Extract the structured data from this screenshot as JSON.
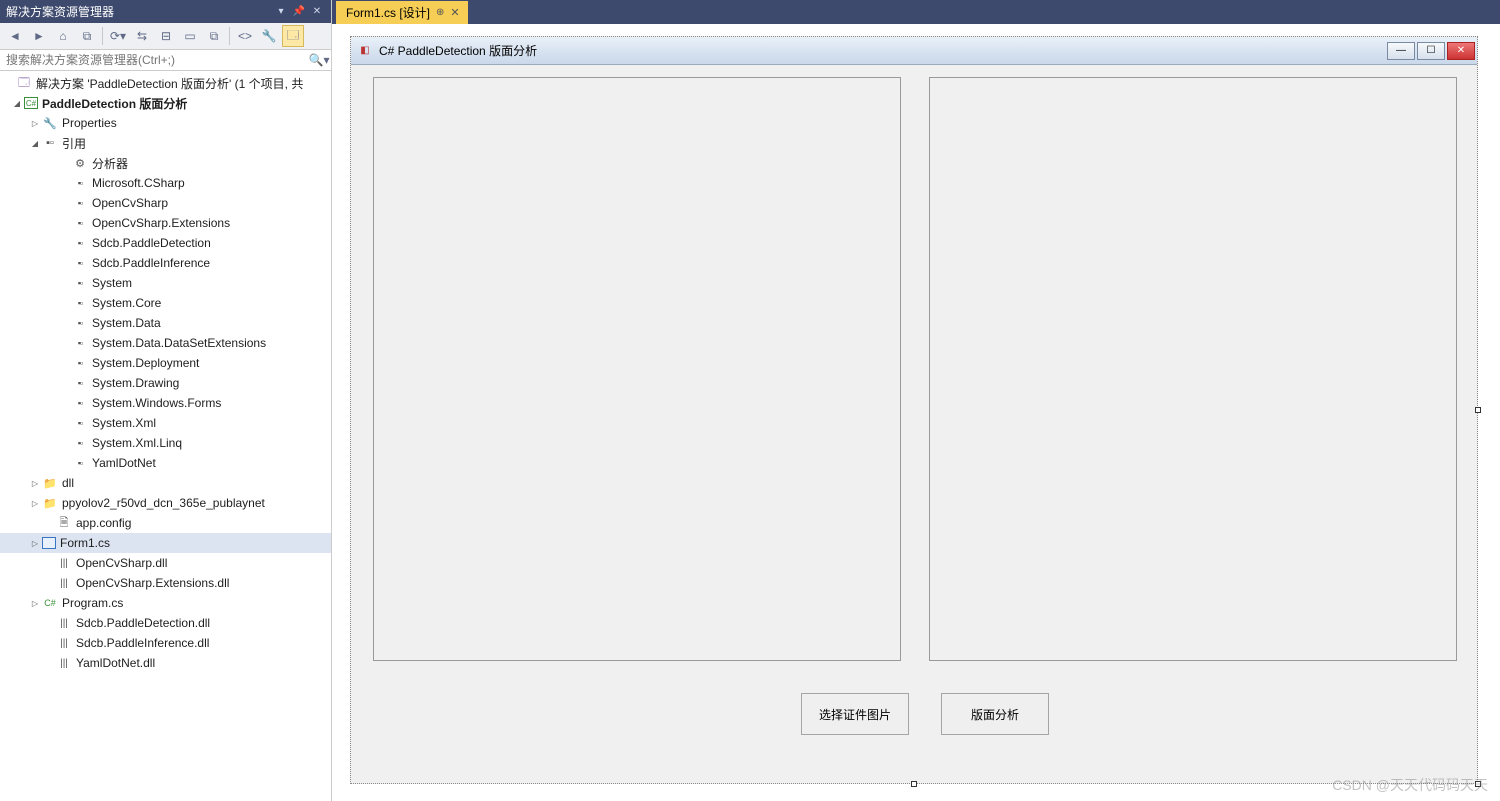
{
  "solutionExplorer": {
    "title": "解决方案资源管理器",
    "searchPlaceholder": "搜索解决方案资源管理器(Ctrl+;)",
    "tree": {
      "solution": "解决方案 'PaddleDetection 版面分析' (1 个项目, 共",
      "project": "PaddleDetection 版面分析",
      "properties": "Properties",
      "references": "引用",
      "analyzers": "分析器",
      "refs": [
        "Microsoft.CSharp",
        "OpenCvSharp",
        "OpenCvSharp.Extensions",
        "Sdcb.PaddleDetection",
        "Sdcb.PaddleInference",
        "System",
        "System.Core",
        "System.Data",
        "System.Data.DataSetExtensions",
        "System.Deployment",
        "System.Drawing",
        "System.Windows.Forms",
        "System.Xml",
        "System.Xml.Linq",
        "YamlDotNet"
      ],
      "folder1": "dll",
      "folder2": "ppyolov2_r50vd_dcn_365e_publaynet",
      "appconfig": "app.config",
      "form1": "Form1.cs",
      "files": [
        "OpenCvSharp.dll",
        "OpenCvSharp.Extensions.dll"
      ],
      "program": "Program.cs",
      "dlls": [
        "Sdcb.PaddleDetection.dll",
        "Sdcb.PaddleInference.dll",
        "YamlDotNet.dll"
      ]
    }
  },
  "editor": {
    "tab": {
      "label": "Form1.cs [设计]"
    }
  },
  "designer": {
    "formTitle": "C# PaddleDetection 版面分析",
    "button1": "选择证件图片",
    "button2": "版面分析"
  },
  "watermark": "CSDN @天天代码码天天"
}
